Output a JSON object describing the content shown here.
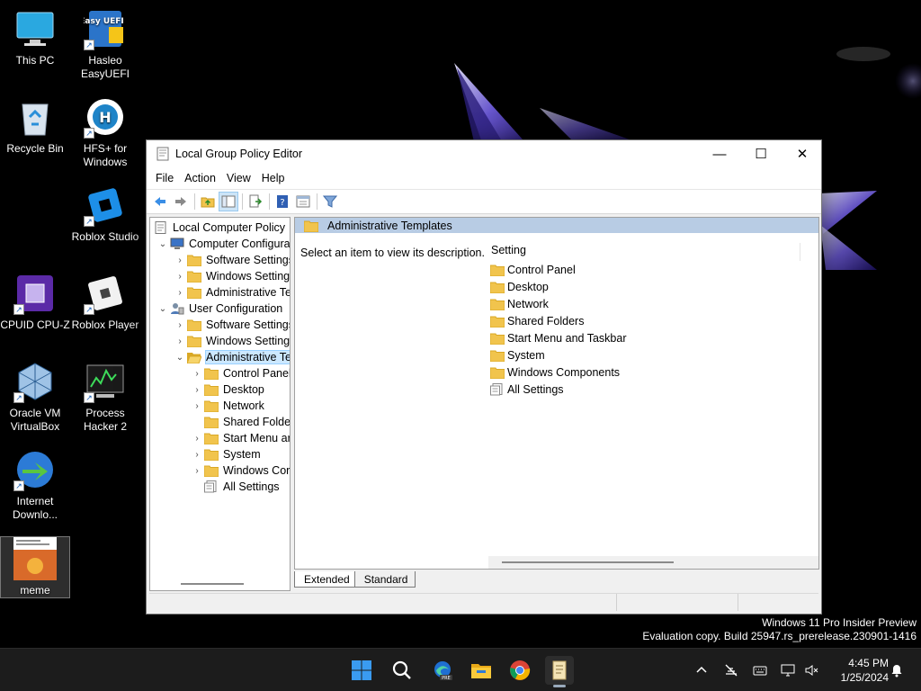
{
  "desktop": {
    "icons": [
      {
        "label": "This PC",
        "icon": "monitor-icon"
      },
      {
        "label": "Hasleo\nEasyUEFI",
        "icon": "easyuefi-icon",
        "badge": "Easy\nUEFI"
      },
      {
        "label": "Recycle Bin",
        "icon": "recycle-bin-icon"
      },
      {
        "label": "HFS+ for\nWindows",
        "icon": "hfs-icon",
        "badge": "H"
      },
      {
        "label": "Roblox Studio",
        "icon": "roblox-studio-icon"
      },
      {
        "label": "CPUID CPU-Z",
        "icon": "cpu-z-icon"
      },
      {
        "label": "Roblox Player",
        "icon": "roblox-player-icon"
      },
      {
        "label": "Oracle VM\nVirtualBox",
        "icon": "virtualbox-icon"
      },
      {
        "label": "Process\nHacker 2",
        "icon": "process-hacker-icon"
      },
      {
        "label": "Internet\nDownlo...",
        "icon": "internet-download-manager-icon"
      },
      {
        "label": "meme",
        "icon": "meme-thumbnail"
      }
    ]
  },
  "window": {
    "title": "Local Group Policy Editor",
    "controls": {
      "minimize": "—",
      "maximize": "☐",
      "close": "✕"
    },
    "menu": [
      "File",
      "Action",
      "View",
      "Help"
    ],
    "toolbar": [
      "back-arrow-icon",
      "forward-arrow-icon",
      "up-folder-icon",
      "show-hide-tree-icon",
      "export-list-icon",
      "help-icon",
      "properties-icon",
      "filter-icon"
    ],
    "tree": [
      {
        "label": "Local Computer Policy",
        "level": 0,
        "expander": "",
        "icon": "policy-icon"
      },
      {
        "label": "Computer Configura",
        "level": 1,
        "expander": "⌄",
        "icon": "computer-icon"
      },
      {
        "label": "Software Settings",
        "level": 2,
        "expander": "›",
        "icon": "folder-icon"
      },
      {
        "label": "Windows Setting",
        "level": 2,
        "expander": "›",
        "icon": "folder-icon"
      },
      {
        "label": "Administrative Te",
        "level": 2,
        "expander": "›",
        "icon": "folder-icon"
      },
      {
        "label": "User Configuration",
        "level": 1,
        "expander": "⌄",
        "icon": "user-icon"
      },
      {
        "label": "Software Settings",
        "level": 2,
        "expander": "›",
        "icon": "folder-icon"
      },
      {
        "label": "Windows Setting",
        "level": 2,
        "expander": "›",
        "icon": "folder-icon"
      },
      {
        "label": "Administrative Te",
        "level": 2,
        "expander": "⌄",
        "icon": "folder-open-icon",
        "selected": true
      },
      {
        "label": "Control Panel",
        "level": 3,
        "expander": "›",
        "icon": "folder-icon"
      },
      {
        "label": "Desktop",
        "level": 3,
        "expander": "›",
        "icon": "folder-icon"
      },
      {
        "label": "Network",
        "level": 3,
        "expander": "›",
        "icon": "folder-icon"
      },
      {
        "label": "Shared Folder",
        "level": 3,
        "expander": "",
        "icon": "folder-icon"
      },
      {
        "label": "Start Menu ar",
        "level": 3,
        "expander": "›",
        "icon": "folder-icon"
      },
      {
        "label": "System",
        "level": 3,
        "expander": "›",
        "icon": "folder-icon"
      },
      {
        "label": "Windows Cor",
        "level": 3,
        "expander": "›",
        "icon": "folder-icon"
      },
      {
        "label": "All Settings",
        "level": 3,
        "expander": "",
        "icon": "settings-list-icon"
      }
    ],
    "right": {
      "header": "Administrative Templates",
      "description": "Select an item to view its description.",
      "column": "Setting",
      "items": [
        {
          "label": "Control Panel",
          "icon": "folder-icon"
        },
        {
          "label": "Desktop",
          "icon": "folder-icon"
        },
        {
          "label": "Network",
          "icon": "folder-icon"
        },
        {
          "label": "Shared Folders",
          "icon": "folder-icon"
        },
        {
          "label": "Start Menu and Taskbar",
          "icon": "folder-icon"
        },
        {
          "label": "System",
          "icon": "folder-icon"
        },
        {
          "label": "Windows Components",
          "icon": "folder-icon"
        },
        {
          "label": "All Settings",
          "icon": "settings-list-icon"
        }
      ]
    },
    "tabs": [
      "Extended",
      "Standard"
    ]
  },
  "watermark": {
    "line1": "Windows 11 Pro Insider Preview",
    "line2": "Evaluation copy. Build 25947.rs_prerelease.230901-1416"
  },
  "taskbar": {
    "apps": [
      "start-icon",
      "search-icon",
      "edge-preview-icon",
      "file-explorer-icon",
      "chrome-icon",
      "group-policy-editor-icon"
    ],
    "edge_badge": "PRE",
    "tray": [
      "chevron-up-icon",
      "network-off-icon",
      "keyboard-icon",
      "display-icon",
      "speaker-mute-icon"
    ],
    "time": "4:45 PM",
    "date": "1/25/2024",
    "notification_icon": "bell-icon"
  },
  "colors": {
    "folder": "#f1c44d",
    "folder_dark": "#d9a825",
    "header_band": "#b8cce4",
    "selection": "#cce8ff",
    "taskbar": "#1c1c1c"
  }
}
